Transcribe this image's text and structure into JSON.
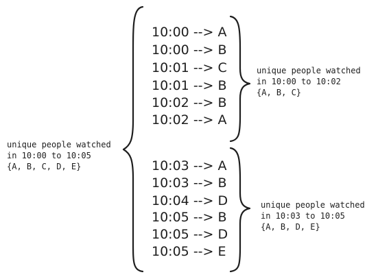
{
  "groups": [
    {
      "events": [
        {
          "time": "10:00",
          "arrow": "-->",
          "user": "A"
        },
        {
          "time": "10:00",
          "arrow": "-->",
          "user": "B"
        },
        {
          "time": "10:01",
          "arrow": "-->",
          "user": "C"
        },
        {
          "time": "10:01",
          "arrow": "-->",
          "user": "B"
        },
        {
          "time": "10:02",
          "arrow": "-->",
          "user": "B"
        },
        {
          "time": "10:02",
          "arrow": "-->",
          "user": "A"
        }
      ],
      "note": {
        "line1": "unique people watched",
        "line2": "in 10:00 to 10:02",
        "line3": "{A, B, C}"
      }
    },
    {
      "events": [
        {
          "time": "10:03",
          "arrow": "-->",
          "user": "A"
        },
        {
          "time": "10:03",
          "arrow": "-->",
          "user": "B"
        },
        {
          "time": "10:04",
          "arrow": "-->",
          "user": "D"
        },
        {
          "time": "10:05",
          "arrow": "-->",
          "user": "B"
        },
        {
          "time": "10:05",
          "arrow": "-->",
          "user": "D"
        },
        {
          "time": "10:05",
          "arrow": "-->",
          "user": "E"
        }
      ],
      "note": {
        "line1": "unique people watched",
        "line2": "in 10:03 to 10:05",
        "line3": "{A, B, D, E}"
      }
    }
  ],
  "overall_note": {
    "line1": "unique people watched",
    "line2": "in 10:00 to 10:05",
    "line3": "{A, B, C, D, E}"
  },
  "colors": {
    "ink": "#1e1e1e",
    "background": "#ffffff"
  }
}
